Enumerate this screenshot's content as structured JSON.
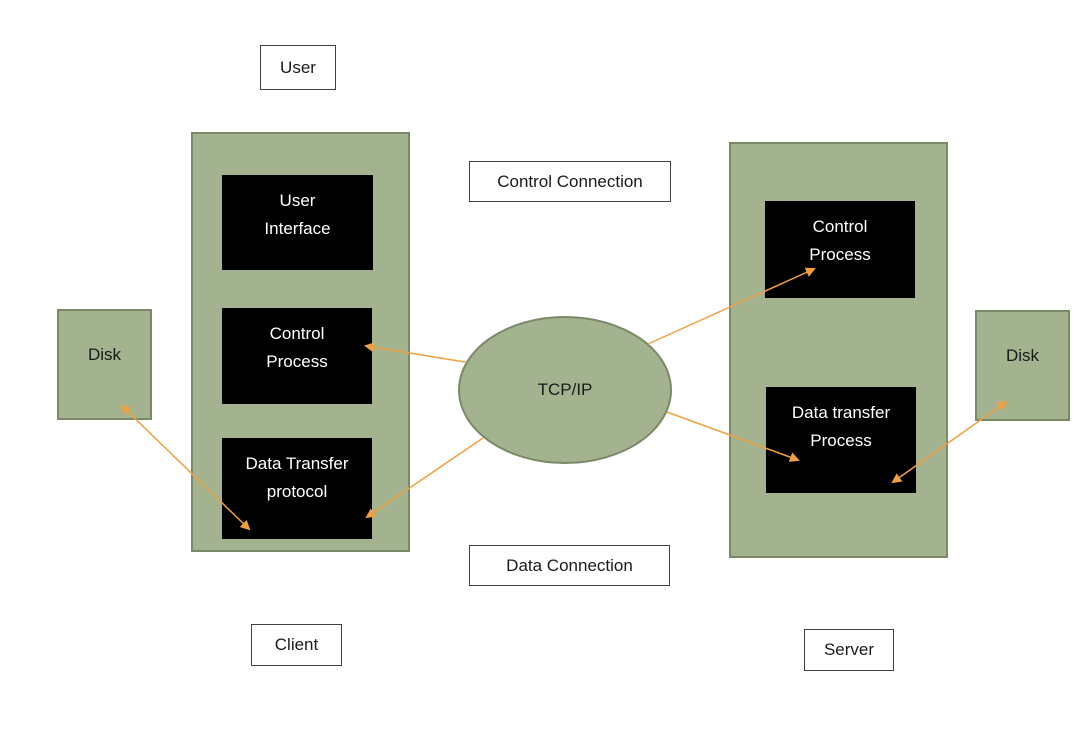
{
  "labels": {
    "user": "User",
    "client": "Client",
    "server": "Server",
    "control_connection": "Control Connection",
    "data_connection": "Data Connection"
  },
  "client": {
    "user_interface": [
      "User",
      "Interface"
    ],
    "control_process": [
      "Control",
      "Process"
    ],
    "data_transfer": [
      "Data Transfer",
      "protocol"
    ]
  },
  "server": {
    "control_process": [
      "Control",
      "Process"
    ],
    "data_transfer": [
      "Data transfer",
      "Process"
    ]
  },
  "network": {
    "label": "TCP/IP"
  },
  "disks": {
    "client_disk": "Disk",
    "server_disk": "Disk"
  },
  "colors": {
    "container_fill": "#a3b38f",
    "container_border": "#7a8a68",
    "process_fill": "#000000",
    "arrow": "#f0a040"
  }
}
